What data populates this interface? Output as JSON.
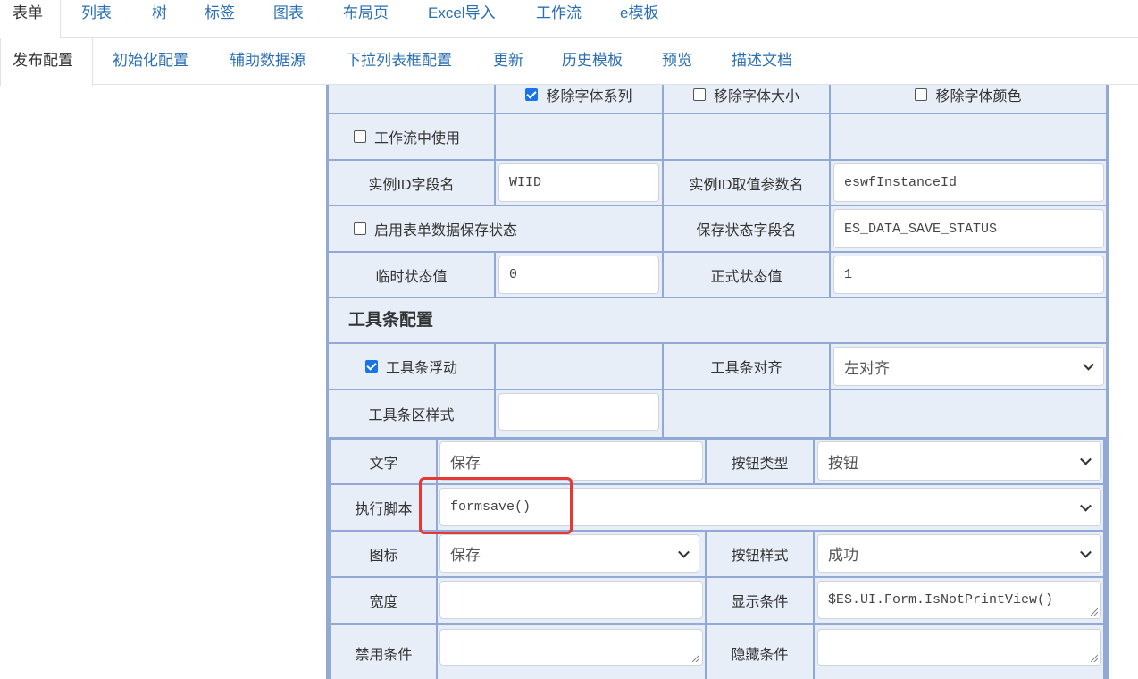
{
  "tabs_primary": [
    "表单",
    "列表",
    "树",
    "标签",
    "图表",
    "布局页",
    "Excel导入",
    "工作流",
    "e模板"
  ],
  "tabs_secondary": [
    "发布配置",
    "初始化配置",
    "辅助数据源",
    "下拉列表框配置",
    "更新",
    "历史模板",
    "预览",
    "描述文档"
  ],
  "font_options": {
    "remove_font_family": {
      "label": "移除字体系列",
      "checked": true
    },
    "remove_font_size": {
      "label": "移除字体大小",
      "checked": false
    },
    "remove_font_color": {
      "label": "移除字体颜色",
      "checked": false
    }
  },
  "workflow": {
    "use_in_workflow": {
      "label": "工作流中使用",
      "checked": false
    },
    "instance_id_field_label": "实例ID字段名",
    "instance_id_field_value": "WIID",
    "instance_id_param_label": "实例ID取值参数名",
    "instance_id_param_value": "eswfInstanceId"
  },
  "save_status": {
    "enable": {
      "label": "启用表单数据保存状态",
      "checked": false
    },
    "field_label": "保存状态字段名",
    "field_value": "ES_DATA_SAVE_STATUS",
    "temp_label": "临时状态值",
    "temp_value": "0",
    "formal_label": "正式状态值",
    "formal_value": "1"
  },
  "toolbar": {
    "section_title": "工具条配置",
    "float": {
      "label": "工具条浮动",
      "checked": true
    },
    "align_label": "工具条对齐",
    "align_value": "左对齐",
    "style_label": "工具条区样式",
    "style_value": ""
  },
  "button": {
    "text_label": "文字",
    "text_value": "保存",
    "type_label": "按钮类型",
    "type_value": "按钮",
    "script_label": "执行脚本",
    "script_value": "formsave()",
    "icon_label": "图标",
    "icon_value": "保存",
    "style_label": "按钮样式",
    "style_value": "成功",
    "width_label": "宽度",
    "width_value": "",
    "show_cond_label": "显示条件",
    "show_cond_value": "$ES.UI.Form.IsNotPrintView()",
    "disable_cond_label": "禁用条件",
    "disable_cond_value": "",
    "hide_cond_label": "隐藏条件",
    "hide_cond_value": ""
  },
  "colors": {
    "accent": "#2a6fb3",
    "grid": "#91a9d4",
    "cell_bg": "#e8eef8",
    "highlight": "#e53935",
    "check": "#1a73e8"
  }
}
